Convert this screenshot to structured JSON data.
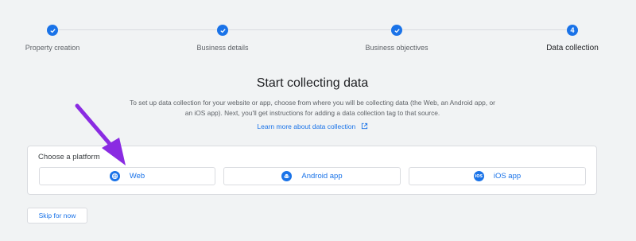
{
  "stepper": {
    "steps": [
      {
        "label": "Property creation",
        "status": "done"
      },
      {
        "label": "Business details",
        "status": "done"
      },
      {
        "label": "Business objectives",
        "status": "done"
      },
      {
        "label": "Data collection",
        "number": "4",
        "status": "current"
      }
    ]
  },
  "main": {
    "title": "Start collecting data",
    "description": "To set up data collection for your website or app, choose from where you will be collecting data (the Web, an Android app, or an iOS app). Next, you'll get instructions for adding a data collection tag to that source.",
    "learn_more": "Learn more about data collection"
  },
  "platform_card": {
    "title": "Choose a platform",
    "buttons": [
      {
        "label": "Web",
        "icon": "globe-icon"
      },
      {
        "label": "Android app",
        "icon": "android-icon"
      },
      {
        "label": "iOS app",
        "icon": "ios-icon",
        "icon_text": "iOS"
      }
    ]
  },
  "skip_label": "Skip for now",
  "colors": {
    "accent": "#1a73e8",
    "background": "#f1f3f4",
    "annotation_arrow": "#8a2be2"
  }
}
